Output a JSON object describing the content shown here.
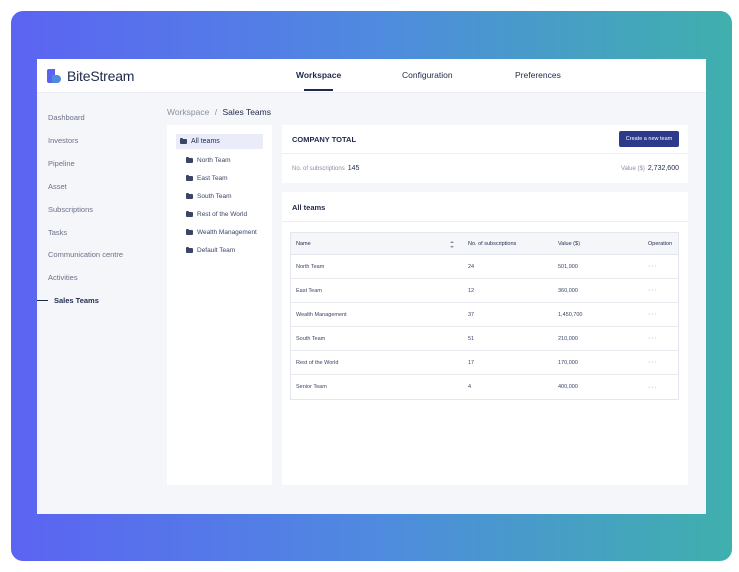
{
  "app": {
    "brand": "BiteStream"
  },
  "topnav": {
    "tabs": [
      {
        "label": "Workspace"
      },
      {
        "label": "Configuration"
      },
      {
        "label": "Preferences"
      }
    ]
  },
  "sidebar": {
    "items": [
      {
        "label": "Dashboard"
      },
      {
        "label": "Investors"
      },
      {
        "label": "Pipeline"
      },
      {
        "label": "Asset"
      },
      {
        "label": "Subscriptions"
      },
      {
        "label": "Tasks"
      },
      {
        "label": "Communication centre"
      },
      {
        "label": "Activities"
      },
      {
        "label": "Sales Teams"
      }
    ]
  },
  "breadcrumb": {
    "root": "Workspace",
    "separator": "/",
    "current": "Sales Teams"
  },
  "tree": {
    "items": [
      {
        "label": "All teams"
      },
      {
        "label": "North Team"
      },
      {
        "label": "East Team"
      },
      {
        "label": "South Team"
      },
      {
        "label": "Rest of the World"
      },
      {
        "label": "Wealth Management"
      },
      {
        "label": "Default Team"
      }
    ]
  },
  "company": {
    "title": "COMPANY TOTAL",
    "create_label": "Create a new team",
    "subs_label": "No. of subscriptions",
    "subs_value": "145",
    "value_label": "Value ($)",
    "value_value": "2,732,600"
  },
  "teams": {
    "title": "All teams",
    "columns": {
      "name": "Name",
      "subs": "No. of subscriptions",
      "value": "Value ($)",
      "op": "Operation"
    },
    "rows": [
      {
        "name": "North Team",
        "subs": "24",
        "value": "501,900",
        "op": "···"
      },
      {
        "name": "East Team",
        "subs": "12",
        "value": "360,000",
        "op": "···"
      },
      {
        "name": "Wealth Management",
        "subs": "37",
        "value": "1,450,700",
        "op": "···"
      },
      {
        "name": "South Team",
        "subs": "51",
        "value": "210,000",
        "op": "···"
      },
      {
        "name": "Rest of the World",
        "subs": "17",
        "value": "170,000",
        "op": "···"
      },
      {
        "name": "Senior Team",
        "subs": "4",
        "value": "400,000",
        "op": "···"
      }
    ]
  },
  "colors": {
    "accent": "#2d3a8c",
    "brand": "#5a63f0",
    "gradient_start": "#5c63f2",
    "gradient_end": "#3fb0ad"
  }
}
